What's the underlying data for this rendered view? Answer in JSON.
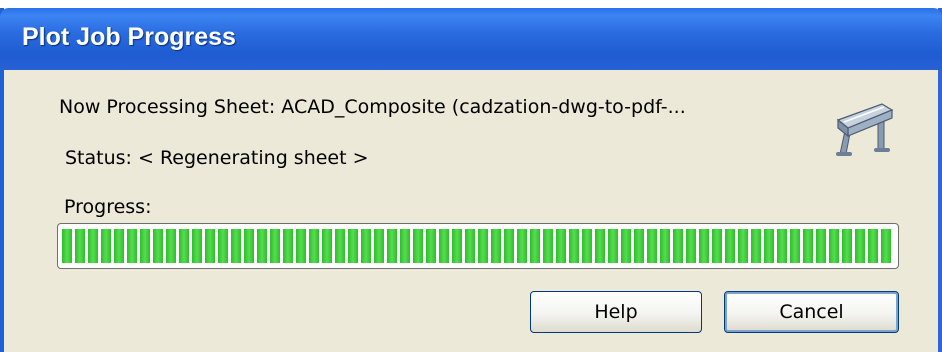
{
  "dialog": {
    "title": "Plot Job Progress",
    "processing_text": "Now Processing Sheet: ACAD_Composite (cadzation-dwg-to-pdf-...",
    "status_text": "Status: < Regenerating sheet >",
    "progress_label": "Progress:",
    "progress_fraction": 1.0,
    "icon": "plotter-icon"
  },
  "buttons": {
    "help_label": "Help",
    "cancel_label": "Cancel"
  },
  "colors": {
    "titlebar": "#2a6ce0",
    "window_bg": "#ece9d8",
    "progress_green": "#2dbd2d"
  }
}
